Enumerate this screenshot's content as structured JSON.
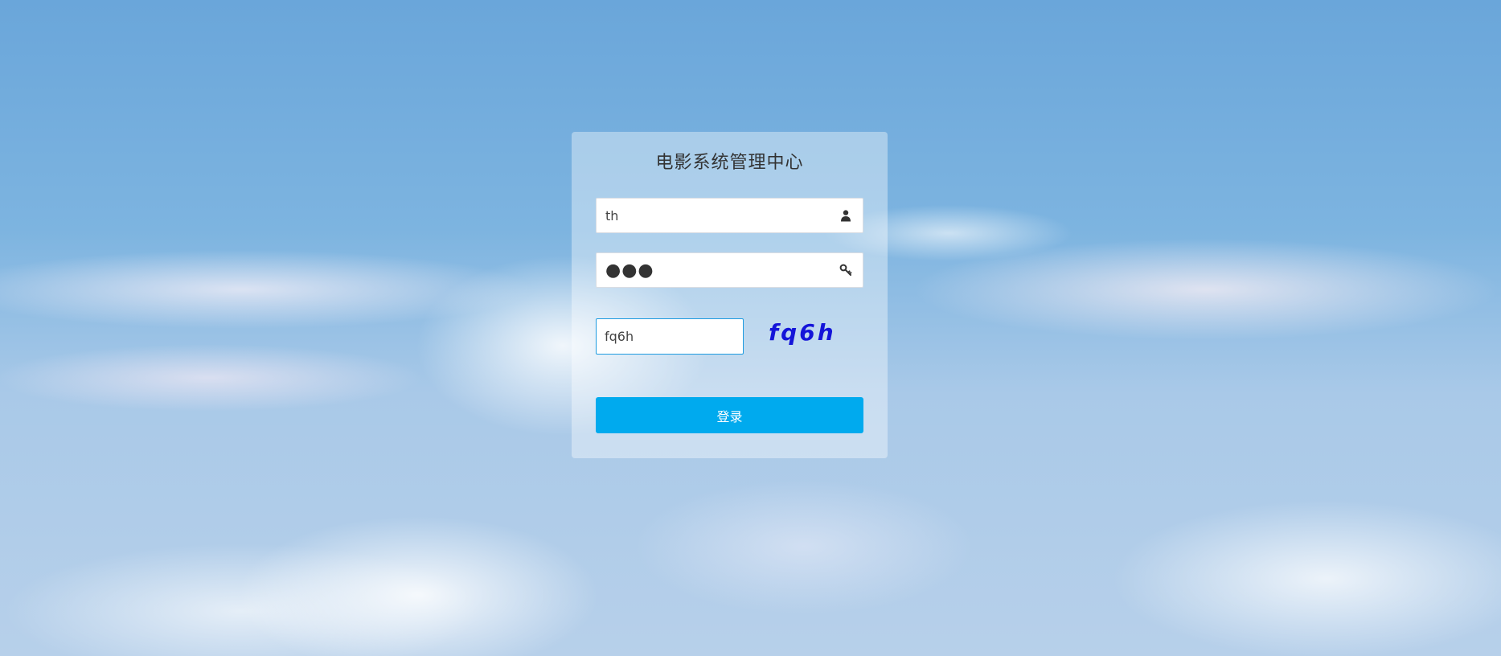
{
  "login": {
    "title": "电影系统管理中心",
    "username": {
      "value": "th",
      "icon": "user-icon"
    },
    "password": {
      "value": "●●●",
      "icon": "key-icon"
    },
    "captcha": {
      "input_value": "fq6h",
      "image_text": "fq6h"
    },
    "submit_label": "登录"
  },
  "colors": {
    "button": "#00aaee",
    "captcha_text": "#1414d9",
    "captcha_border": "#1e9be0"
  }
}
